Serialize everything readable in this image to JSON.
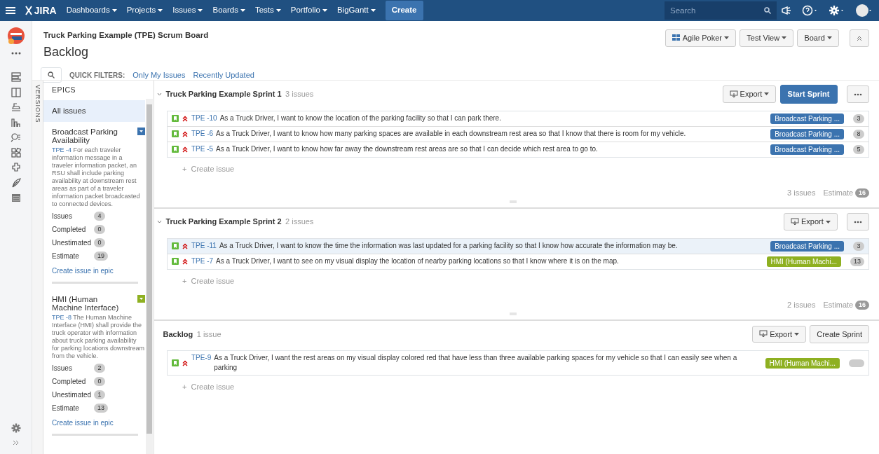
{
  "nav": {
    "logo": "JIRA",
    "menus": [
      {
        "label": "Dashboards"
      },
      {
        "label": "Projects"
      },
      {
        "label": "Issues"
      },
      {
        "label": "Boards"
      },
      {
        "label": "Tests"
      },
      {
        "label": "Portfolio"
      },
      {
        "label": "BigGantt"
      }
    ],
    "create": "Create",
    "search": {
      "placeholder": "Search"
    }
  },
  "header": {
    "board_title": "Truck Parking Example (TPE) Scrum Board",
    "page_title": "Backlog",
    "quick_filters_label": "QUICK FILTERS:",
    "quick_filters": [
      {
        "label": "Only My Issues"
      },
      {
        "label": "Recently Updated"
      }
    ],
    "buttons": [
      {
        "label": "Agile Poker",
        "kind": "poker"
      },
      {
        "label": "Test View",
        "kind": "dropdown"
      },
      {
        "label": "Board",
        "kind": "dropdown"
      }
    ]
  },
  "side_tab": "VERSIONS",
  "epics": {
    "title": "EPICS",
    "all_issues": {
      "label": "All issues",
      "selected": true
    },
    "items": [
      {
        "name": "Broadcast Parking Availability",
        "color": "#3b73af",
        "key": "TPE -4",
        "description": "For each traveler information message in a traveler information packet, an RSU shall include parking availability at downstream rest areas as part of a traveler information packet broadcasted to connected devices.",
        "stats": [
          {
            "label": "Issues",
            "value": "4"
          },
          {
            "label": "Completed",
            "value": "0"
          },
          {
            "label": "Unestimated",
            "value": "0"
          },
          {
            "label": "Estimate",
            "value": "19"
          }
        ],
        "create_link": "Create issue in epic"
      },
      {
        "name": "HMI (Human Machine Interface)",
        "color": "#8eb021",
        "key": "TPE -8",
        "description": "The Human Machine Interface (HMI) shall provide the truck operator with information about truck parking availability for parking locations downstream from the vehicle.",
        "stats": [
          {
            "label": "Issues",
            "value": "2"
          },
          {
            "label": "Completed",
            "value": "0"
          },
          {
            "label": "Unestimated",
            "value": "1"
          },
          {
            "label": "Estimate",
            "value": "13"
          }
        ],
        "create_link": "Create issue in epic"
      }
    ]
  },
  "sprints": [
    {
      "name": "Truck Parking Example Sprint 1",
      "count": "3 issues",
      "collapsible": true,
      "buttons": [
        {
          "label": "Export",
          "kind": "export"
        },
        {
          "label": "Start Sprint",
          "kind": "primary"
        },
        {
          "kind": "more"
        }
      ],
      "issues": [
        {
          "key": "TPE -10",
          "summary": "As a Truck Driver, I want to know the location of the parking facility so that I can park there.",
          "epic": "Broadcast Parking ...",
          "color": "#3b73af",
          "estimate": "3",
          "selected": false
        },
        {
          "key": "TPE -6",
          "summary": "As a Truck Driver, I want to know how many parking spaces are available in each downstream rest area so that I know that there is room for my vehicle.",
          "epic": "Broadcast Parking ...",
          "color": "#3b73af",
          "estimate": "8",
          "selected": false
        },
        {
          "key": "TPE -5",
          "summary": "As a Truck Driver, I want to know how far away the downstream rest areas are so that I can decide which rest area to go to.",
          "epic": "Broadcast Parking ...",
          "color": "#3b73af",
          "estimate": "5",
          "selected": false
        }
      ],
      "create_issue": "+  Create issue",
      "footer": {
        "issues": "3 issues",
        "estimate_label": "Estimate",
        "estimate": "16"
      }
    },
    {
      "name": "Truck Parking Example Sprint 2",
      "count": "2 issues",
      "collapsible": true,
      "buttons": [
        {
          "label": "Export",
          "kind": "export"
        },
        {
          "kind": "more"
        }
      ],
      "issues": [
        {
          "key": "TPE -11",
          "summary": "As a Truck Driver, I want to know the time the information was last updated for a parking facility so that I know how accurate the information may be.",
          "epic": "Broadcast Parking ...",
          "color": "#3b73af",
          "estimate": "3",
          "selected": true
        },
        {
          "key": "TPE -7",
          "summary": "As a Truck Driver, I want to see on my visual display the location of nearby parking locations so that I know where it is on the map.",
          "epic": "HMI (Human Machi...",
          "color": "#8eb021",
          "estimate": "13",
          "selected": false
        }
      ],
      "create_issue": "+  Create issue",
      "footer": {
        "issues": "2 issues",
        "estimate_label": "Estimate",
        "estimate": "16"
      }
    },
    {
      "name": "Backlog",
      "count": "1 issue",
      "collapsible": false,
      "buttons": [
        {
          "label": "Export",
          "kind": "export"
        },
        {
          "label": "Create Sprint",
          "kind": "default"
        }
      ],
      "issues": [
        {
          "key": "TPE-9",
          "summary": "As a Truck Driver, I want the rest areas on my visual display colored red that have less than three available parking spaces for my vehicle so that I can easily see when a parking",
          "epic": "HMI (Human Machi...",
          "color": "#8eb021",
          "selected": false
        }
      ],
      "create_issue": "+  Create issue"
    }
  ]
}
